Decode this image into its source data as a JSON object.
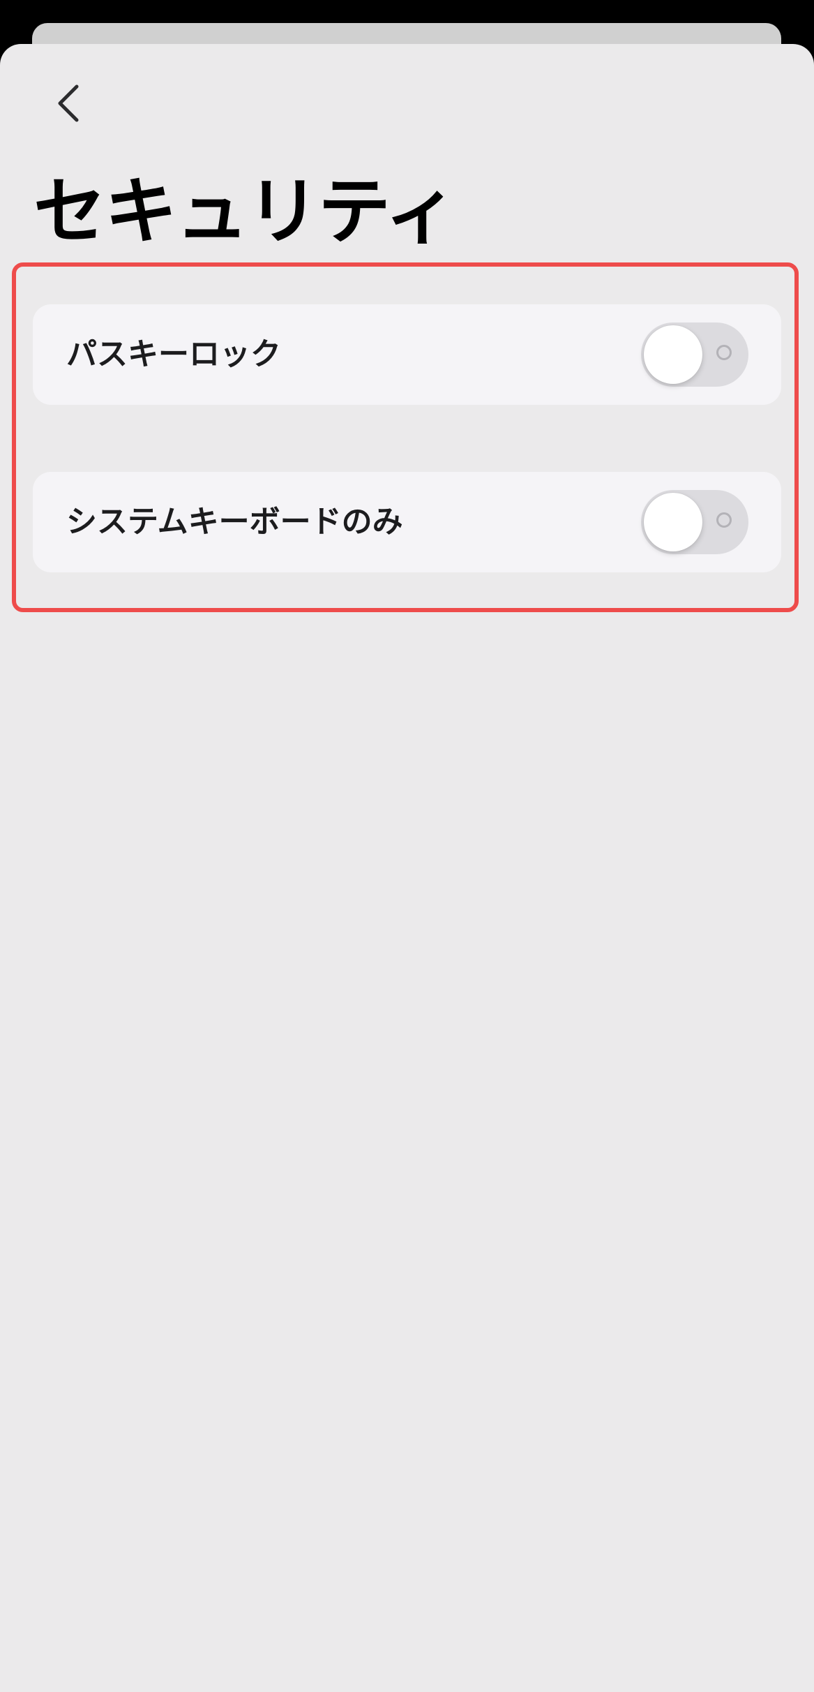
{
  "header": {
    "title": "セキュリティ",
    "back_icon": "chevron-left-icon"
  },
  "settings": [
    {
      "label": "パスキーロック",
      "enabled": false
    },
    {
      "label": "システムキーボードのみ",
      "enabled": false
    }
  ],
  "colors": {
    "sheet_background": "#ebeaeb",
    "row_background": "#f5f4f7",
    "toggle_off_track": "#dcdbdf",
    "highlight_border": "#ee4c4b"
  }
}
